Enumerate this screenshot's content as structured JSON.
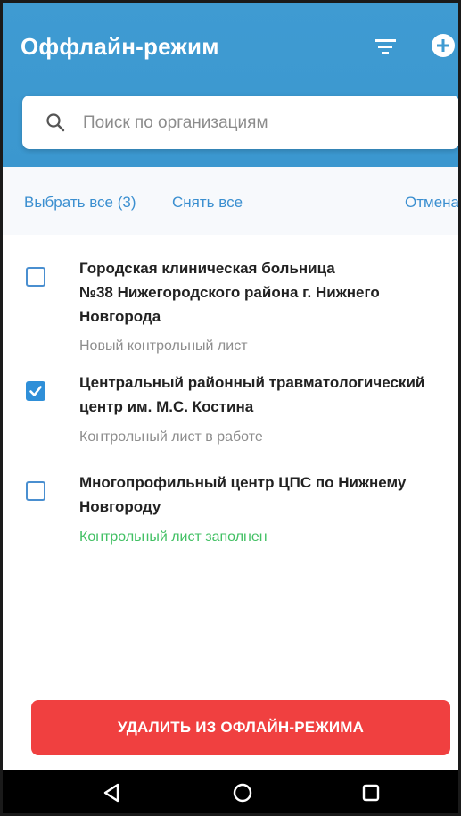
{
  "header": {
    "title": "Оффлайн-режим",
    "filter_icon": "filter-icon",
    "add_icon": "add-circle-icon"
  },
  "search": {
    "placeholder": "Поиск по организациям",
    "value": ""
  },
  "actions": {
    "select_all": "Выбрать все (3)",
    "deselect_all": "Снять все",
    "cancel": "Отмена"
  },
  "items": [
    {
      "title_lines": [
        "Городская клиническая больница",
        "№38 Нижегородского района г. Нижнего",
        "Новгорода"
      ],
      "status": "Новый контрольный лист",
      "checked": false
    },
    {
      "title_lines": [
        "Центральный районный травматологический",
        "центр им. М.С. Костина"
      ],
      "status": "Контрольный лист в работе",
      "checked": true
    },
    {
      "title_lines": [
        "Многопрофильный центр ЦПС по Нижнему",
        "Новгороду"
      ],
      "status": "Контрольный лист заполнен",
      "checked": false
    }
  ],
  "delete_button": {
    "label": "УДАЛИТЬ ИЗ ОФЛАЙН-РЕЖИМА"
  },
  "navbar": {
    "back": "back-icon",
    "home": "home-icon",
    "recents": "recents-icon"
  },
  "colors": {
    "header": "#3f9bd2",
    "link": "#3b8fd0",
    "checkbox": "#2f8fd8",
    "status_done": "#42c064",
    "delete": "#f04040"
  }
}
